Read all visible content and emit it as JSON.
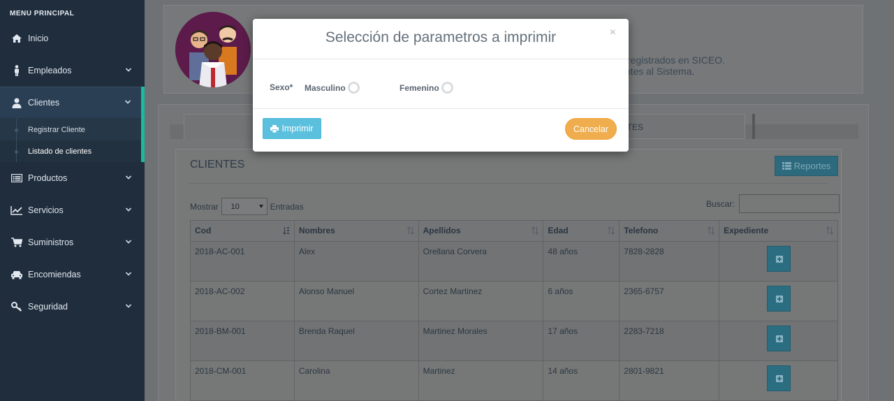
{
  "sidebar": {
    "title": "MENU PRINCIPAL",
    "items": [
      {
        "label": "Inicio",
        "icon": "home-icon"
      },
      {
        "label": "Empleados",
        "icon": "employee-icon"
      },
      {
        "label": "Clientes",
        "icon": "user-icon"
      },
      {
        "label": "Productos",
        "icon": "list-icon"
      },
      {
        "label": "Servicios",
        "icon": "chart-line-icon"
      },
      {
        "label": "Suministros",
        "icon": "cart-icon"
      },
      {
        "label": "Encomiendas",
        "icon": "car-icon"
      },
      {
        "label": "Seguridad",
        "icon": "key-icon"
      }
    ],
    "submenu": [
      {
        "label": "Registrar Cliente"
      },
      {
        "label": "Listado de clientes"
      }
    ]
  },
  "header": {
    "welcome_line1": "s registrados en SICEO.",
    "welcome_line2": "entes al Sistema."
  },
  "tabs": {
    "right_label": "NTES"
  },
  "clientes": {
    "title": "CLIENTES",
    "reportes_label": "Reportes",
    "mostrar_label": "Mostrar",
    "entries_value": "10",
    "entradas_label": "Entradas",
    "buscar_label": "Buscar:",
    "columns": [
      "Cod",
      "Nombres",
      "Apellidos",
      "Edad",
      "Telefono",
      "Expediente"
    ],
    "rows": [
      {
        "cod": "2018-AC-001",
        "nombres": "Alex",
        "apellidos": "Orellana Corvera",
        "edad": "48 años",
        "telefono": "7828-2828"
      },
      {
        "cod": "2018-AC-002",
        "nombres": "Alonso Manuel",
        "apellidos": "Cortez Martinez",
        "edad": "6 años",
        "telefono": "2365-6757"
      },
      {
        "cod": "2018-BM-001",
        "nombres": "Brenda Raquel",
        "apellidos": "Martinez Morales",
        "edad": "17 años",
        "telefono": "2283-7218"
      },
      {
        "cod": "2018-CM-001",
        "nombres": "Carolina",
        "apellidos": "Martinez",
        "edad": "14 años",
        "telefono": "2801-9821"
      }
    ]
  },
  "modal": {
    "title": "Selección de parametros a imprimir",
    "close": "×",
    "sexo_label": "Sexo*",
    "option_masculino": "Masculino",
    "option_femenino": "Femenino",
    "imprimir_label": "Imprimir",
    "cancelar_label": "Cancelar"
  },
  "colors": {
    "accent": "#1abb9c",
    "info": "#5bc0de",
    "warning": "#f0ad4e",
    "sidebar_bg": "#1f2d3d"
  }
}
